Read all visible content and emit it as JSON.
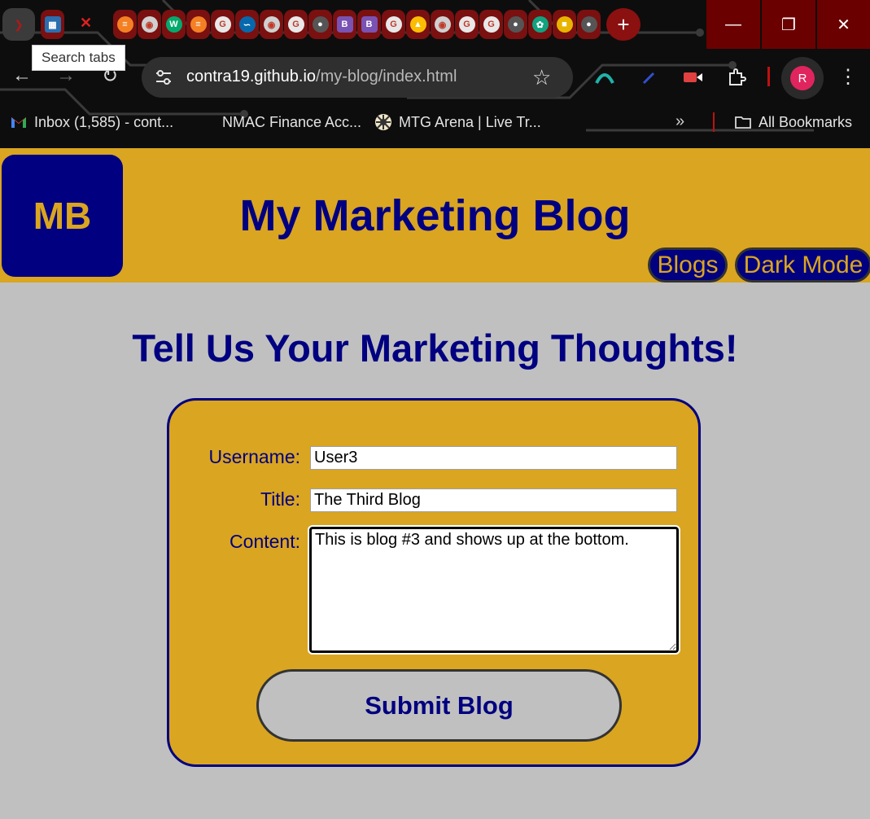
{
  "browser": {
    "tooltip": "Search tabs",
    "url_host": "contra19.github.io",
    "url_path": "/my-blog/index.html",
    "profile_initial": "R",
    "bookmarks": [
      {
        "label": "Inbox (1,585) - cont...",
        "icon": "gmail-icon"
      },
      {
        "label": "NMAC Finance Acc...",
        "icon": "nissan-icon"
      },
      {
        "label": "MTG Arena | Live Tr...",
        "icon": "mtg-icon"
      }
    ],
    "all_bookmarks_label": "All Bookmarks",
    "pinned_tab_favicons": [
      "stackoverflow-icon",
      "chrome-icon",
      "w3schools-icon",
      "stackoverflow-icon",
      "google-icon",
      "jquery-icon",
      "chrome-icon",
      "google-icon",
      "globe-icon",
      "bootstrap-icon",
      "bootstrap-icon",
      "google-icon",
      "drive-icon",
      "chrome-icon",
      "google-icon",
      "google-icon",
      "globe-icon",
      "openai-icon",
      "flag-icon",
      "globe-icon"
    ],
    "colors": {
      "accent": "#8b1010",
      "frame": "#6b0000"
    }
  },
  "header": {
    "logo_text": "MB",
    "title": "My Marketing Blog",
    "nav": {
      "blogs_label": "Blogs",
      "dark_mode_label": "Dark Mode"
    }
  },
  "form": {
    "heading": "Tell Us Your Marketing Thoughts!",
    "username_label": "Username:",
    "username_value": "User3",
    "title_label": "Title:",
    "title_value": "The Third Blog",
    "content_label": "Content:",
    "content_value": "This is blog #3 and shows up at the bottom.",
    "submit_label": "Submit Blog"
  },
  "colors": {
    "navy": "#000080",
    "goldenrod": "#daa520",
    "silver": "#c0c0c0"
  }
}
